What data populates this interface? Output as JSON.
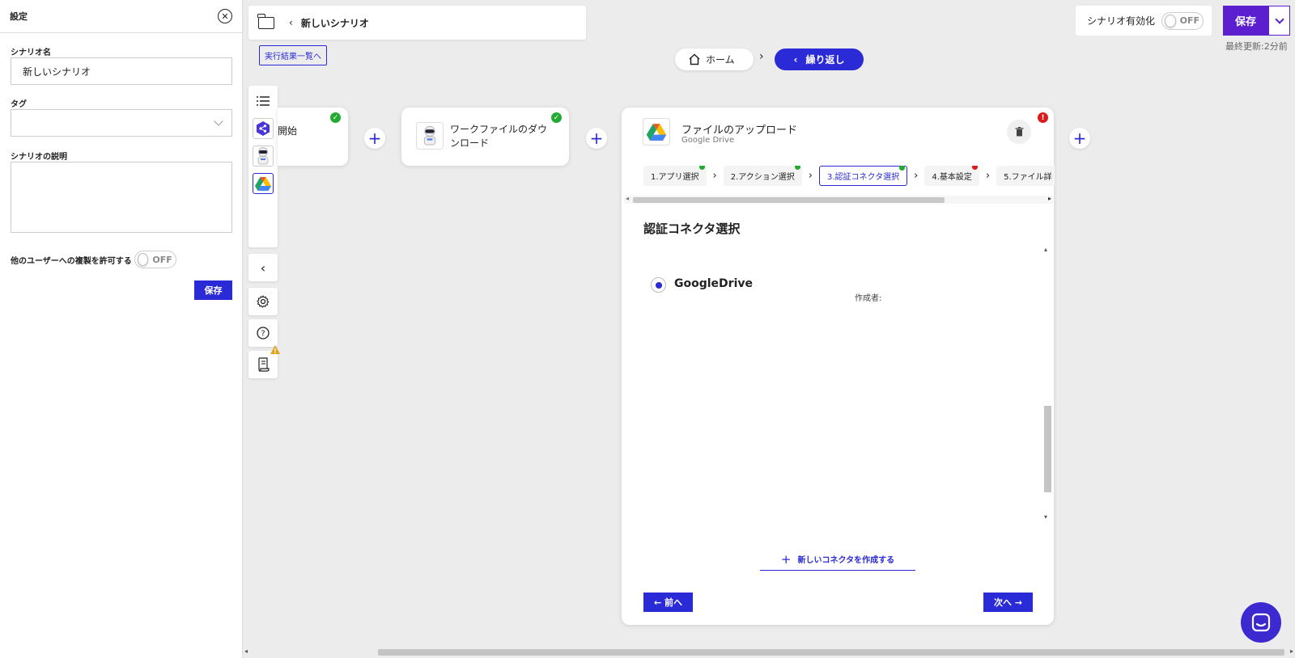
{
  "settings": {
    "title": "設定",
    "name_label": "シナリオ名",
    "name_value": "新しいシナリオ",
    "tag_label": "タグ",
    "description_label": "シナリオの説明",
    "copy_label": "他のユーザーへの複製を許可する",
    "copy_toggle": "OFF",
    "save_label": "保存"
  },
  "topbar": {
    "scenario_title": "新しいシナリオ",
    "results_link": "実行結果一覧へ"
  },
  "header_right": {
    "enable_label": "シナリオ有効化",
    "enable_toggle": "OFF",
    "save_label": "保存",
    "last_updated": "最終更新:2分前"
  },
  "breadcrumb": {
    "home": "ホーム",
    "current": "繰り返し"
  },
  "cards": {
    "start_label": "開始",
    "download_label": "ワークファイルのダウンロード",
    "upload": {
      "title": "ファイルのアップロード",
      "subtitle": "Google Drive",
      "steps": [
        {
          "label": "1.アプリ選択",
          "status": "ok"
        },
        {
          "label": "2.アクション選択",
          "status": "ok"
        },
        {
          "label": "3.認証コネクタ選択",
          "status": "ok"
        },
        {
          "label": "4.基本設定",
          "status": "error"
        },
        {
          "label": "5.ファイル詳",
          "status": "none"
        }
      ],
      "section_title": "認証コネクタ選択",
      "connector_name": "GoogleDrive",
      "author_label": "作成者:",
      "new_connector": "新しいコネクタを作成する",
      "prev_label": "← 前へ",
      "next_label": "次へ →"
    }
  },
  "colors": {
    "primary": "#2a2ad6",
    "save_purple": "#5b1fcf",
    "ok_green": "#22aa33",
    "error_red": "#d81b1b"
  }
}
